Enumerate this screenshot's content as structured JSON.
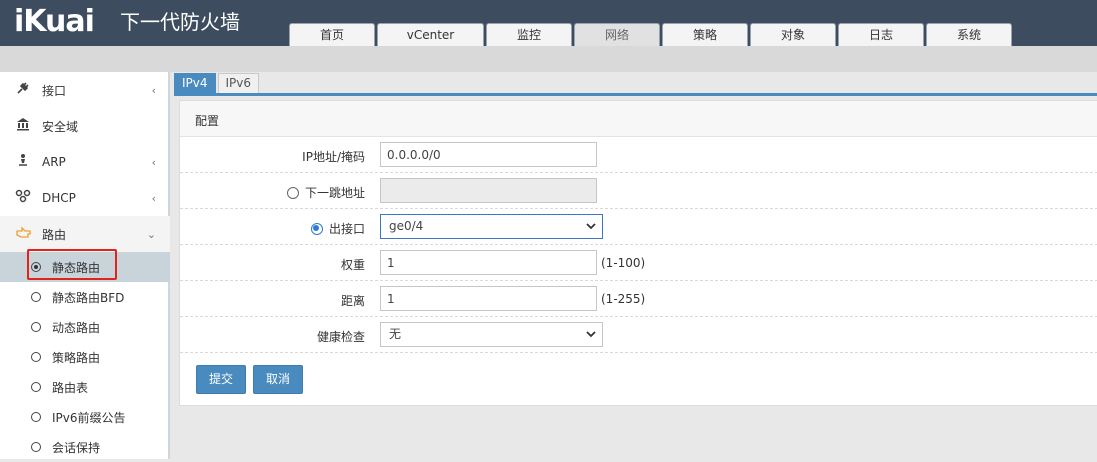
{
  "header": {
    "logo": "iKuai",
    "subtitle": "下一代防火墙",
    "tabs": [
      {
        "label": "首页"
      },
      {
        "label": "vCenter"
      },
      {
        "label": "监控"
      },
      {
        "label": "网络",
        "active": true
      },
      {
        "label": "策略"
      },
      {
        "label": "对象"
      },
      {
        "label": "日志"
      },
      {
        "label": "系统"
      }
    ]
  },
  "sidebar": {
    "items": [
      {
        "label": "接口",
        "icon": "plug-icon",
        "arrow": "‹"
      },
      {
        "label": "安全域",
        "icon": "bank-icon",
        "arrow": ""
      },
      {
        "label": "ARP",
        "icon": "person-icon",
        "arrow": "‹"
      },
      {
        "label": "DHCP",
        "icon": "network-icon",
        "arrow": "‹"
      },
      {
        "label": "路由",
        "icon": "hand-point-icon",
        "arrow": "⌄"
      }
    ],
    "sub_items": [
      {
        "label": "静态路由",
        "active": true
      },
      {
        "label": "静态路由BFD"
      },
      {
        "label": "动态路由"
      },
      {
        "label": "策略路由"
      },
      {
        "label": "路由表"
      },
      {
        "label": "IPv6前缀公告"
      },
      {
        "label": "会话保持"
      }
    ]
  },
  "content_tabs": [
    {
      "label": "IPv4",
      "active": true
    },
    {
      "label": "IPv6"
    }
  ],
  "form": {
    "title": "配置",
    "ip_mask": {
      "label": "IP地址/掩码",
      "value": "0.0.0.0/0"
    },
    "next_hop": {
      "label": "下一跳地址",
      "value": "",
      "selected": false
    },
    "out_interface": {
      "label": "出接口",
      "value": "ge0/4",
      "selected": true
    },
    "weight": {
      "label": "权重",
      "value": "1",
      "hint": "(1-100)"
    },
    "distance": {
      "label": "距离",
      "value": "1",
      "hint": "(1-255)"
    },
    "health_check": {
      "label": "健康检查",
      "value": "无"
    }
  },
  "buttons": {
    "submit": "提交",
    "cancel": "取消"
  },
  "colors": {
    "header_bg": "#3d4d5f",
    "accent": "#4a8bbf",
    "highlight_box": "#e2231a"
  }
}
